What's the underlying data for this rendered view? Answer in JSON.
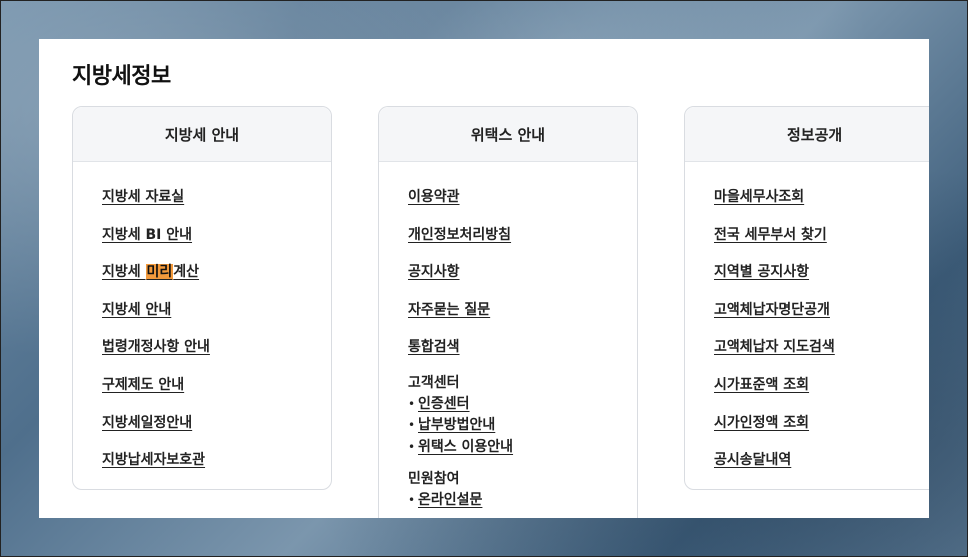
{
  "page": {
    "title": "지방세정보"
  },
  "columns": [
    {
      "title": "지방세 안내",
      "links": [
        "지방세 자료실",
        "지방세 BI 안내",
        "지방세 미리계산",
        "지방세 안내",
        "법령개정사항 안내",
        "구제제도 안내",
        "지방세일정안내",
        "지방납세자보호관"
      ],
      "highlight": {
        "before": "지방세 ",
        "mark": "미리",
        "after": "계산",
        "color": "#f39a3c"
      }
    },
    {
      "title": "위택스 안내",
      "links": [
        "이용약관",
        "개인정보처리방침",
        "공지사항",
        "자주묻는 질문",
        "통합검색"
      ],
      "groups": [
        {
          "title": "고객센터",
          "items": [
            "인증센터",
            "납부방법안내",
            "위택스 이용안내"
          ]
        },
        {
          "title": "민원참여",
          "items": [
            "온라인설문"
          ]
        }
      ]
    },
    {
      "title": "정보공개",
      "links": [
        "마을세무사조회",
        "전국 세무부서 찾기",
        "지역별 공지사항",
        "고액체납자명단공개",
        "고액체납자 지도검색",
        "시가표준액 조회",
        "시가인정액 조회",
        "공시송달내역"
      ]
    }
  ],
  "bullet": "•"
}
